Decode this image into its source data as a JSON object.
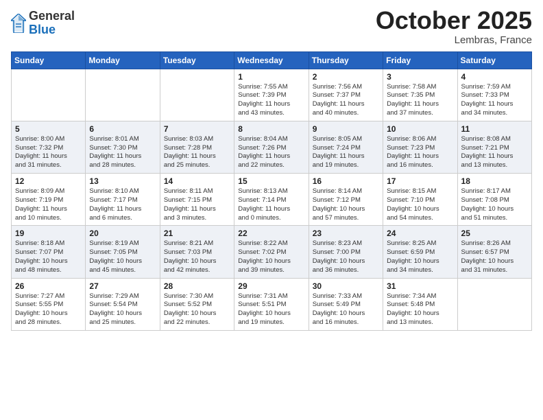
{
  "logo": {
    "general": "General",
    "blue": "Blue"
  },
  "header": {
    "month": "October 2025",
    "location": "Lembras, France"
  },
  "weekdays": [
    "Sunday",
    "Monday",
    "Tuesday",
    "Wednesday",
    "Thursday",
    "Friday",
    "Saturday"
  ],
  "weeks": [
    [
      {
        "day": "",
        "info": ""
      },
      {
        "day": "",
        "info": ""
      },
      {
        "day": "",
        "info": ""
      },
      {
        "day": "1",
        "info": "Sunrise: 7:55 AM\nSunset: 7:39 PM\nDaylight: 11 hours\nand 43 minutes."
      },
      {
        "day": "2",
        "info": "Sunrise: 7:56 AM\nSunset: 7:37 PM\nDaylight: 11 hours\nand 40 minutes."
      },
      {
        "day": "3",
        "info": "Sunrise: 7:58 AM\nSunset: 7:35 PM\nDaylight: 11 hours\nand 37 minutes."
      },
      {
        "day": "4",
        "info": "Sunrise: 7:59 AM\nSunset: 7:33 PM\nDaylight: 11 hours\nand 34 minutes."
      }
    ],
    [
      {
        "day": "5",
        "info": "Sunrise: 8:00 AM\nSunset: 7:32 PM\nDaylight: 11 hours\nand 31 minutes."
      },
      {
        "day": "6",
        "info": "Sunrise: 8:01 AM\nSunset: 7:30 PM\nDaylight: 11 hours\nand 28 minutes."
      },
      {
        "day": "7",
        "info": "Sunrise: 8:03 AM\nSunset: 7:28 PM\nDaylight: 11 hours\nand 25 minutes."
      },
      {
        "day": "8",
        "info": "Sunrise: 8:04 AM\nSunset: 7:26 PM\nDaylight: 11 hours\nand 22 minutes."
      },
      {
        "day": "9",
        "info": "Sunrise: 8:05 AM\nSunset: 7:24 PM\nDaylight: 11 hours\nand 19 minutes."
      },
      {
        "day": "10",
        "info": "Sunrise: 8:06 AM\nSunset: 7:23 PM\nDaylight: 11 hours\nand 16 minutes."
      },
      {
        "day": "11",
        "info": "Sunrise: 8:08 AM\nSunset: 7:21 PM\nDaylight: 11 hours\nand 13 minutes."
      }
    ],
    [
      {
        "day": "12",
        "info": "Sunrise: 8:09 AM\nSunset: 7:19 PM\nDaylight: 11 hours\nand 10 minutes."
      },
      {
        "day": "13",
        "info": "Sunrise: 8:10 AM\nSunset: 7:17 PM\nDaylight: 11 hours\nand 6 minutes."
      },
      {
        "day": "14",
        "info": "Sunrise: 8:11 AM\nSunset: 7:15 PM\nDaylight: 11 hours\nand 3 minutes."
      },
      {
        "day": "15",
        "info": "Sunrise: 8:13 AM\nSunset: 7:14 PM\nDaylight: 11 hours\nand 0 minutes."
      },
      {
        "day": "16",
        "info": "Sunrise: 8:14 AM\nSunset: 7:12 PM\nDaylight: 10 hours\nand 57 minutes."
      },
      {
        "day": "17",
        "info": "Sunrise: 8:15 AM\nSunset: 7:10 PM\nDaylight: 10 hours\nand 54 minutes."
      },
      {
        "day": "18",
        "info": "Sunrise: 8:17 AM\nSunset: 7:08 PM\nDaylight: 10 hours\nand 51 minutes."
      }
    ],
    [
      {
        "day": "19",
        "info": "Sunrise: 8:18 AM\nSunset: 7:07 PM\nDaylight: 10 hours\nand 48 minutes."
      },
      {
        "day": "20",
        "info": "Sunrise: 8:19 AM\nSunset: 7:05 PM\nDaylight: 10 hours\nand 45 minutes."
      },
      {
        "day": "21",
        "info": "Sunrise: 8:21 AM\nSunset: 7:03 PM\nDaylight: 10 hours\nand 42 minutes."
      },
      {
        "day": "22",
        "info": "Sunrise: 8:22 AM\nSunset: 7:02 PM\nDaylight: 10 hours\nand 39 minutes."
      },
      {
        "day": "23",
        "info": "Sunrise: 8:23 AM\nSunset: 7:00 PM\nDaylight: 10 hours\nand 36 minutes."
      },
      {
        "day": "24",
        "info": "Sunrise: 8:25 AM\nSunset: 6:59 PM\nDaylight: 10 hours\nand 34 minutes."
      },
      {
        "day": "25",
        "info": "Sunrise: 8:26 AM\nSunset: 6:57 PM\nDaylight: 10 hours\nand 31 minutes."
      }
    ],
    [
      {
        "day": "26",
        "info": "Sunrise: 7:27 AM\nSunset: 5:55 PM\nDaylight: 10 hours\nand 28 minutes."
      },
      {
        "day": "27",
        "info": "Sunrise: 7:29 AM\nSunset: 5:54 PM\nDaylight: 10 hours\nand 25 minutes."
      },
      {
        "day": "28",
        "info": "Sunrise: 7:30 AM\nSunset: 5:52 PM\nDaylight: 10 hours\nand 22 minutes."
      },
      {
        "day": "29",
        "info": "Sunrise: 7:31 AM\nSunset: 5:51 PM\nDaylight: 10 hours\nand 19 minutes."
      },
      {
        "day": "30",
        "info": "Sunrise: 7:33 AM\nSunset: 5:49 PM\nDaylight: 10 hours\nand 16 minutes."
      },
      {
        "day": "31",
        "info": "Sunrise: 7:34 AM\nSunset: 5:48 PM\nDaylight: 10 hours\nand 13 minutes."
      },
      {
        "day": "",
        "info": ""
      }
    ]
  ]
}
